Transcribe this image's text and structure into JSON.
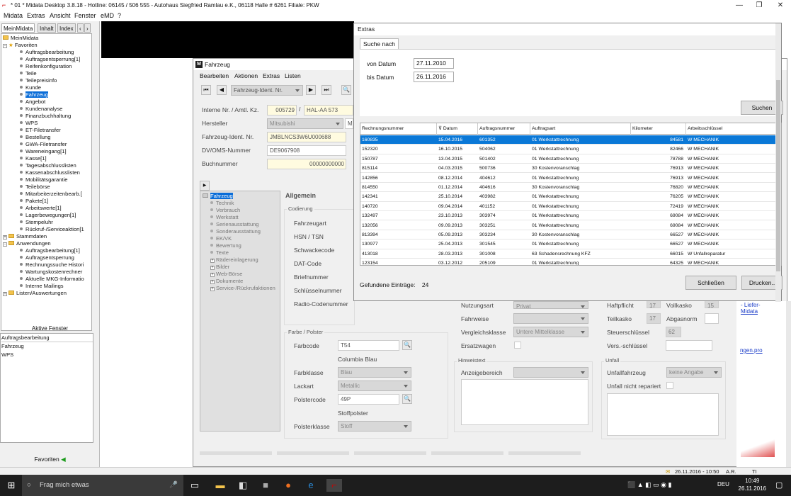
{
  "titlebar": {
    "title": "* 01 * Midata Desktop 3.8.18 - Hotline: 06145 / 506 555 - Autohaus Siegfried Ramlau e.K., 06118 Halle        # 6261  Filiale: PKW",
    "min": "—",
    "max": "❐",
    "close": "✕"
  },
  "menubar": [
    "Midata",
    "Extras",
    "Ansicht",
    "Fenster",
    "eMD",
    "?"
  ],
  "left": {
    "tabs": [
      "MeinMidata",
      "Inhalt",
      "Index",
      "‹",
      "›"
    ],
    "tree": [
      {
        "t": "MeinMidata",
        "k": "folder",
        "pm": "",
        "i": 0
      },
      {
        "t": "Favoriten",
        "k": "star",
        "pm": "-",
        "i": 0
      },
      {
        "t": "Auftragsbearbeitung",
        "k": "b",
        "i": 2
      },
      {
        "t": "Auftragsentsperrung[1]",
        "k": "b",
        "i": 2
      },
      {
        "t": "Reifenkonfiguration",
        "k": "b",
        "i": 2
      },
      {
        "t": "Teile",
        "k": "b",
        "i": 2
      },
      {
        "t": "Teilepreisinfo",
        "k": "b",
        "i": 2
      },
      {
        "t": "Kunde",
        "k": "b",
        "i": 2
      },
      {
        "t": "Fahrzeug",
        "k": "b",
        "i": 2,
        "sel": true
      },
      {
        "t": "Angebot",
        "k": "b",
        "i": 2
      },
      {
        "t": "Kundenanalyse",
        "k": "b",
        "i": 2
      },
      {
        "t": "Finanzbuchhaltung",
        "k": "b",
        "i": 2
      },
      {
        "t": "WPS",
        "k": "b",
        "i": 2
      },
      {
        "t": "ET-Filetransfer",
        "k": "b",
        "i": 2
      },
      {
        "t": "Bestellung",
        "k": "b",
        "i": 2
      },
      {
        "t": "GWA-Filetransfer",
        "k": "b",
        "i": 2
      },
      {
        "t": "Wareneingang[1]",
        "k": "b",
        "i": 2
      },
      {
        "t": "Kasse[1]",
        "k": "b",
        "i": 2
      },
      {
        "t": "Tagesabschlusslisten",
        "k": "b",
        "i": 2
      },
      {
        "t": "Kassenabschlusslisten",
        "k": "b",
        "i": 2
      },
      {
        "t": "Mobilitätsgarantie",
        "k": "b",
        "i": 2
      },
      {
        "t": "Teilebörse",
        "k": "b",
        "i": 2
      },
      {
        "t": "Mitarbeiterzeitenbearb.[",
        "k": "b",
        "i": 2
      },
      {
        "t": "Pakete[1]",
        "k": "b",
        "i": 2
      },
      {
        "t": "Arbeitswerte[1]",
        "k": "b",
        "i": 2
      },
      {
        "t": "Lagerbewegungen[1]",
        "k": "b",
        "i": 2
      },
      {
        "t": "Stempeluhr",
        "k": "b",
        "i": 2
      },
      {
        "t": "Rückruf-/Serviceaktion[1",
        "k": "b",
        "i": 2
      },
      {
        "t": "Stammdaten",
        "k": "folder",
        "pm": "+",
        "i": 0
      },
      {
        "t": "Anwendungen",
        "k": "folder",
        "pm": "-",
        "i": 0
      },
      {
        "t": "Auftragsbearbeitung[1]",
        "k": "b",
        "i": 2
      },
      {
        "t": "Auftragsentsperrung",
        "k": "b",
        "i": 2
      },
      {
        "t": "Rechnungssuche Histori",
        "k": "b",
        "i": 2
      },
      {
        "t": "Wartungskostenrechner",
        "k": "b",
        "i": 2
      },
      {
        "t": "Aktuelle MKG-Informatio",
        "k": "b",
        "i": 2
      },
      {
        "t": "Interne Mailings",
        "k": "b",
        "i": 2
      },
      {
        "t": "Listen/Auswertungen",
        "k": "folder",
        "pm": "+",
        "i": 0
      }
    ],
    "aktive_header": "Aktive Fenster",
    "aktive": [
      "Auftragsbearbeitung",
      "Fahrzeug",
      "WPS"
    ],
    "fav_button": "Favoriten"
  },
  "fz": {
    "title": "Fahrzeug",
    "menu": [
      "Bearbeiten",
      "Aktionen",
      "Extras",
      "Listen"
    ],
    "nav_combo": "Fahrzeug-Ident. Nr.",
    "labels": {
      "interne": "Interne Nr. / Amtl. Kz.",
      "hersteller": "Hersteller",
      "fin": "Fahrzeug-Ident. Nr.",
      "dv": "DV/OMS-Nummer",
      "buch": "Buchnummer"
    },
    "values": {
      "interne": "005729",
      "kz": "HAL-AA 573",
      "hersteller": "Mitsubishi",
      "hersteller2": "M",
      "fin": "JMBLNCS3W6U000688",
      "dv": "DE9067908",
      "buch": "00000000000"
    },
    "nav": [
      {
        "t": "Fahrzeug",
        "sel": true,
        "i": 0
      },
      {
        "t": "Technik",
        "i": 1
      },
      {
        "t": "Verbrauch",
        "i": 1
      },
      {
        "t": "Werkstatt",
        "i": 1
      },
      {
        "t": "Serienausstattung",
        "i": 1
      },
      {
        "t": "Sonderausstattung",
        "i": 1
      },
      {
        "t": "EK/VK",
        "i": 1
      },
      {
        "t": "Bewertung",
        "i": 1
      },
      {
        "t": "Texte",
        "i": 1
      },
      {
        "t": "Rädereinlagerung",
        "i": 1,
        "pm": true
      },
      {
        "t": "Bilder",
        "i": 1,
        "pm": true
      },
      {
        "t": "Web-Börse",
        "i": 1,
        "pm": true
      },
      {
        "t": "Dokumente",
        "i": 1,
        "pm": true
      },
      {
        "t": "Service-/Rückrufaktionen",
        "i": 1,
        "pm": true
      }
    ],
    "allgemein": "Allgemein",
    "codierung": "Codierung",
    "cod_labels": [
      "Fahrzeugart",
      "HSN / TSN",
      "Schwackecode",
      "DAT-Code",
      "Briefnummer",
      "Schlüsselnummer",
      "Radio-Codenummer"
    ],
    "farbe": {
      "title": "Farbe / Polster",
      "farbcode_l": "Farbcode",
      "farbcode": "T54",
      "farbname": "Columbia Blau",
      "farbklasse_l": "Farbklasse",
      "farbklasse": "Blau",
      "lackart_l": "Lackart",
      "lackart": "Metallic",
      "polstercode_l": "Polstercode",
      "polstercode": "49P",
      "polstername": "Stoffpolster",
      "polsterklasse_l": "Polsterklasse",
      "polsterklasse": "Stoff"
    },
    "mid": {
      "nutzungsart_l": "Nutzungsart",
      "nutzungsart": "Privat",
      "fahrweise_l": "Fahrweise",
      "vergleich_l": "Vergleichsklasse",
      "vergleich": "Untere Mittelklasse",
      "ersatz_l": "Ersatzwagen",
      "hinweis": "Hinweistext",
      "anzeige_l": "Anzeigebereich"
    },
    "right": {
      "haft_l": "Haftpflicht",
      "haft": "17",
      "voll_l": "Vollkasko",
      "voll": "15",
      "teil_l": "Teilkasko",
      "teil": "17",
      "abgas_l": "Abgasnorm",
      "steuer_l": "Steuerschlüssel",
      "steuer": "62",
      "vers_l": "Vers.-schlüssel",
      "unfall": "Unfall",
      "unfallfz_l": "Unfallfahrzeug",
      "unfallfz": "keine Angabe",
      "unfallnr_l": "Unfall nicht repariert"
    },
    "links": {
      "a": "- Liefer-",
      "b": "Midata",
      "c": "ngen.pro"
    }
  },
  "ext": {
    "title": "Extras",
    "tab": "Suche nach",
    "von_l": "von Datum",
    "von": "27.11.2010",
    "bis_l": "bis Datum",
    "bis": "26.11.2016",
    "suchen": "Suchen",
    "cols": [
      "Rechnungsnummer",
      "Datum",
      "Auftragsnummer",
      "Auftragsart",
      "Kilometer",
      "Arbeitsschlüssel"
    ],
    "rows": [
      [
        "160835",
        "15.04.2016",
        "601352",
        "01  Werkstattrechnung",
        "84581",
        "W  MECHANIK"
      ],
      [
        "152320",
        "16.10.2015",
        "504062",
        "01  Werkstattrechnung",
        "82466",
        "W  MECHANIK"
      ],
      [
        "150787",
        "13.04.2015",
        "501402",
        "01  Werkstattrechnung",
        "78788",
        "W  MECHANIK"
      ],
      [
        "815114",
        "04.03.2015",
        "500736",
        "30  Kostenvoranschlag",
        "76913",
        "W  MECHANIK"
      ],
      [
        "142856",
        "08.12.2014",
        "404612",
        "01  Werkstattrechnung",
        "76913",
        "W  MECHANIK"
      ],
      [
        "814550",
        "01.12.2014",
        "404616",
        "30  Kostenvoranschlag",
        "76820",
        "W  MECHANIK"
      ],
      [
        "142341",
        "25.10.2014",
        "403982",
        "01  Werkstattrechnung",
        "76205",
        "W  MECHANIK"
      ],
      [
        "140720",
        "09.04.2014",
        "401152",
        "01  Werkstattrechnung",
        "72419",
        "W  MECHANIK"
      ],
      [
        "132497",
        "23.10.2013",
        "303974",
        "01  Werkstattrechnung",
        "69084",
        "W  MECHANIK"
      ],
      [
        "132056",
        "09.09.2013",
        "303251",
        "01  Werkstattrechnung",
        "69084",
        "W  MECHANIK"
      ],
      [
        "813394",
        "05.09.2013",
        "303234",
        "30  Kostenvoranschlag",
        "66527",
        "W  MECHANIK"
      ],
      [
        "130977",
        "25.04.2013",
        "301545",
        "01  Werkstattrechnung",
        "66527",
        "W  MECHANIK"
      ],
      [
        "413018",
        "28.03.2013",
        "301008",
        "63  Schadensrechnung KFZ",
        "66015",
        "W  Unfallreparatur"
      ],
      [
        "123154",
        "03.12.2012",
        "205109",
        "01  Werkstattrechnung",
        "64325",
        "W  MECHANIK"
      ]
    ],
    "gef_l": "Gefundene Einträge:",
    "gef": "24",
    "schliessen": "Schließen",
    "drucken": "Drucken.."
  },
  "status": {
    "date": "26.11.2016 - 10:50",
    "user": "A.R.",
    "ti": "TI"
  },
  "taskbar": {
    "search": "Frag mich etwas",
    "time": "10:49",
    "date": "26.11.2016",
    "lang": "DEU"
  }
}
